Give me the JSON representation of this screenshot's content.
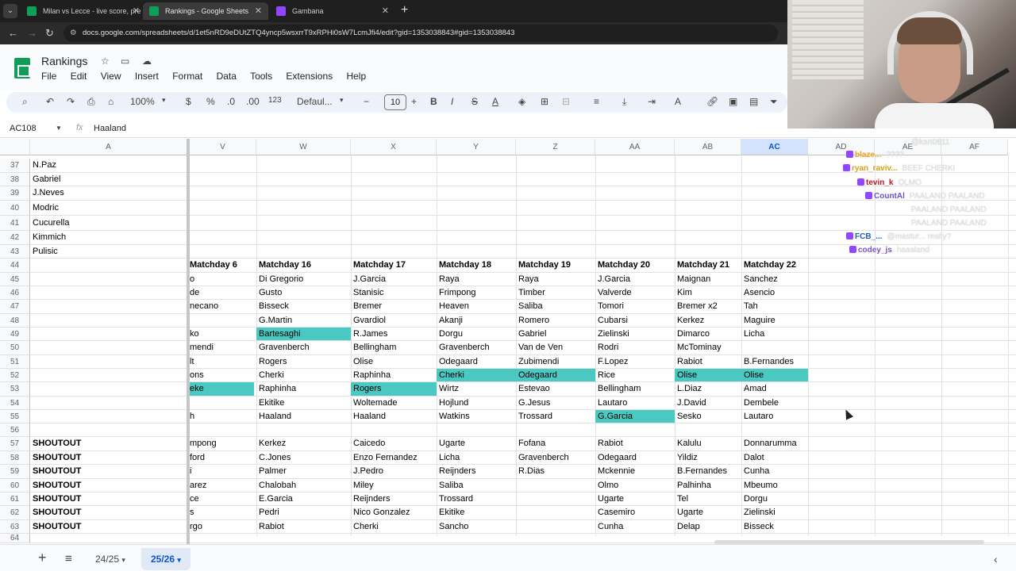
{
  "browser": {
    "tabs": [
      {
        "title": "Milan vs Lecce - live score, pre",
        "favicon_color": "#0f9d58",
        "active": false
      },
      {
        "title": "Rankings - Google Sheets",
        "favicon_color": "#0f9d58",
        "active": true
      },
      {
        "title": "Gambana",
        "favicon_color": "#9146ff",
        "active": false
      }
    ],
    "new_tab_icon": "+",
    "url": "docs.google.com/spreadsheets/d/1et5nRD9eDUtZTQ4yncp5wsxrrT9xRPHi0sW7LcmJfi4/edit?gid=1353038843#gid=1353038843"
  },
  "sheets": {
    "doc_title": "Rankings",
    "menu": [
      "File",
      "Edit",
      "View",
      "Insert",
      "Format",
      "Data",
      "Tools",
      "Extensions",
      "Help"
    ],
    "toolbar": {
      "zoom": "100%",
      "currency": "$",
      "percent": "%",
      "dec_dec": ".0",
      "dec_inc": ".00",
      "num_format": "123",
      "font": "Defaul...",
      "font_size": "10",
      "bold": "B",
      "italic": "I",
      "strike": "S",
      "text_color": "A"
    },
    "formula_bar": {
      "name_box": "AC108",
      "fx": "fx",
      "value": "Haaland"
    },
    "columns": {
      "A": "A",
      "V": "V",
      "W": "W",
      "X": "X",
      "Y": "Y",
      "Z": "Z",
      "AA": "AA",
      "AB": "AB",
      "AC": "AC",
      "AD": "AD",
      "AE": "AE",
      "AF": "AF"
    },
    "rows": [
      "37",
      "38",
      "39",
      "40",
      "41",
      "42",
      "43",
      "44",
      "45",
      "46",
      "47",
      "48",
      "49",
      "50",
      "51",
      "52",
      "53",
      "54",
      "55",
      "56",
      "57",
      "58",
      "59",
      "60",
      "61",
      "62",
      "63",
      "64"
    ],
    "colA": {
      "37": "N.Paz",
      "38": "Gabriel",
      "39": "J.Neves",
      "40": "Modric",
      "41": "Cucurella",
      "42": "Kimmich",
      "43": "Pulisic",
      "57": "SHOUTOUT",
      "58": "SHOUTOUT",
      "59": "SHOUTOUT",
      "60": "SHOUTOUT",
      "61": "SHOUTOUT",
      "62": "SHOUTOUT",
      "63": "SHOUTOUT"
    },
    "headers": {
      "V": "Matchday 6",
      "W": "Matchday 16",
      "X": "Matchday 17",
      "Y": "Matchday 18",
      "Z": "Matchday 19",
      "AA": "Matchday 20",
      "AB": "Matchday 21",
      "AC": "Matchday 22"
    },
    "grid": {
      "45": {
        "V": "o",
        "W": "Di Gregorio",
        "X": "J.Garcia",
        "Y": "Raya",
        "Z": "Raya",
        "AA": "J.Garcia",
        "AB": "Maignan",
        "AC": "Sanchez"
      },
      "46": {
        "V": "de",
        "W": "Gusto",
        "X": "Stanisic",
        "Y": "Frimpong",
        "Z": "Timber",
        "AA": "Valverde",
        "AB": "Kim",
        "AC": "Asencio"
      },
      "47": {
        "V": "necano",
        "W": "Bisseck",
        "X": "Bremer",
        "Y": "Heaven",
        "Z": "Saliba",
        "AA": "Tomori",
        "AB": "Bremer x2",
        "AC": "Tah"
      },
      "48": {
        "V": "",
        "W": "G.Martin",
        "X": "Gvardiol",
        "Y": "Akanji",
        "Z": "Romero",
        "AA": "Cubarsi",
        "AB": "Kerkez",
        "AC": "Maguire"
      },
      "49": {
        "V": "ko",
        "W": "Bartesaghi",
        "X": "R.James",
        "Y": "Dorgu",
        "Z": "Gabriel",
        "AA": "Zielinski",
        "AB": "Dimarco",
        "AC": "Licha"
      },
      "50": {
        "V": "mendi",
        "W": "Gravenberch",
        "X": "Bellingham",
        "Y": "Gravenberch",
        "Z": "Van de Ven",
        "AA": "Rodri",
        "AB": "McTominay",
        "AC": ""
      },
      "51": {
        "V": "lt",
        "W": "Rogers",
        "X": "Olise",
        "Y": "Odegaard",
        "Z": "Zubimendi",
        "AA": "F.Lopez",
        "AB": "Rabiot",
        "AC": "B.Fernandes"
      },
      "52": {
        "V": "ons",
        "W": "Cherki",
        "X": "Raphinha",
        "Y": "Cherki",
        "Z": "Odegaard",
        "AA": "Rice",
        "AB": "Olise",
        "AC": "Olise"
      },
      "53": {
        "V": "eke",
        "W": "Raphinha",
        "X": "Rogers",
        "Y": "Wirtz",
        "Z": "Estevao",
        "AA": "Bellingham",
        "AB": "L.Diaz",
        "AC": "Amad"
      },
      "54": {
        "V": "",
        "W": "Ekitike",
        "X": "Woltemade",
        "Y": "Hojlund",
        "Z": "G.Jesus",
        "AA": "Lautaro",
        "AB": "J.David",
        "AC": "Dembele"
      },
      "55": {
        "V": "h",
        "W": "Haaland",
        "X": "Haaland",
        "Y": "Watkins",
        "Z": "Trossard",
        "AA": "G.Garcia",
        "AB": "Sesko",
        "AC": "Lautaro"
      },
      "57": {
        "V": "mpong",
        "W": "Kerkez",
        "X": "Caicedo",
        "Y": "Ugarte",
        "Z": "Fofana",
        "AA": "Rabiot",
        "AB": "Kalulu",
        "AC": "Donnarumma"
      },
      "58": {
        "V": "ford",
        "W": "C.Jones",
        "X": "Enzo Fernandez",
        "Y": "Licha",
        "Z": "Gravenberch",
        "AA": "Odegaard",
        "AB": "Yildiz",
        "AC": "Dalot"
      },
      "59": {
        "V": "i",
        "W": "Palmer",
        "X": "J.Pedro",
        "Y": "Reijnders",
        "Z": "R.Dias",
        "AA": "Mckennie",
        "AB": "B.Fernandes",
        "AC": "Cunha"
      },
      "60": {
        "V": "arez",
        "W": "Chalobah",
        "X": "Miley",
        "Y": "Saliba",
        "Z": "",
        "AA": "Olmo",
        "AB": "Palhinha",
        "AC": "Mbeumo"
      },
      "61": {
        "V": "ce",
        "W": "E.Garcia",
        "X": "Reijnders",
        "Y": "Trossard",
        "Z": "",
        "AA": "Ugarte",
        "AB": "Tel",
        "AC": "Dorgu"
      },
      "62": {
        "V": "s",
        "W": "Pedri",
        "X": "Nico Gonzalez",
        "Y": "Ekitike",
        "Z": "",
        "AA": "Casemiro",
        "AB": "Ugarte",
        "AC": "Zielinski"
      },
      "63": {
        "V": "rgo",
        "W": "Rabiot",
        "X": "Cherki",
        "Y": "Sancho",
        "Z": "",
        "AA": "Cunha",
        "AB": "Delap",
        "AC": "Bisseck"
      }
    },
    "highlight_color": "#4ac9c3",
    "sheet_tabs": [
      "24/25",
      "25/26"
    ],
    "active_sheet": "25/26"
  },
  "chat": [
    {
      "user": "",
      "color": "#e5e5e5",
      "msg": "@kart0611"
    },
    {
      "user": "blaze...",
      "color": "#e8a317",
      "msg": "????"
    },
    {
      "user": "ryan_raviv...",
      "color": "#d4a017",
      "msg": "BEEF CHERKI"
    },
    {
      "user": "tevin_k",
      "color": "#c0161e",
      "msg": "OLMO"
    },
    {
      "user": "CountAl",
      "color": "#6c4fd6",
      "msg": "PAALAND PAALAND"
    },
    {
      "user": "",
      "color": "#e5e5e5",
      "msg": "PAALAND PAALAND"
    },
    {
      "user": "",
      "color": "#e5e5e5",
      "msg": "PAALAND PAALAND"
    },
    {
      "user": "FCB_...",
      "color": "#1e5fb4",
      "msg": "@mastur... really?"
    },
    {
      "user": "codey_js",
      "color": "#7a52c7",
      "msg": "haaaland"
    }
  ]
}
